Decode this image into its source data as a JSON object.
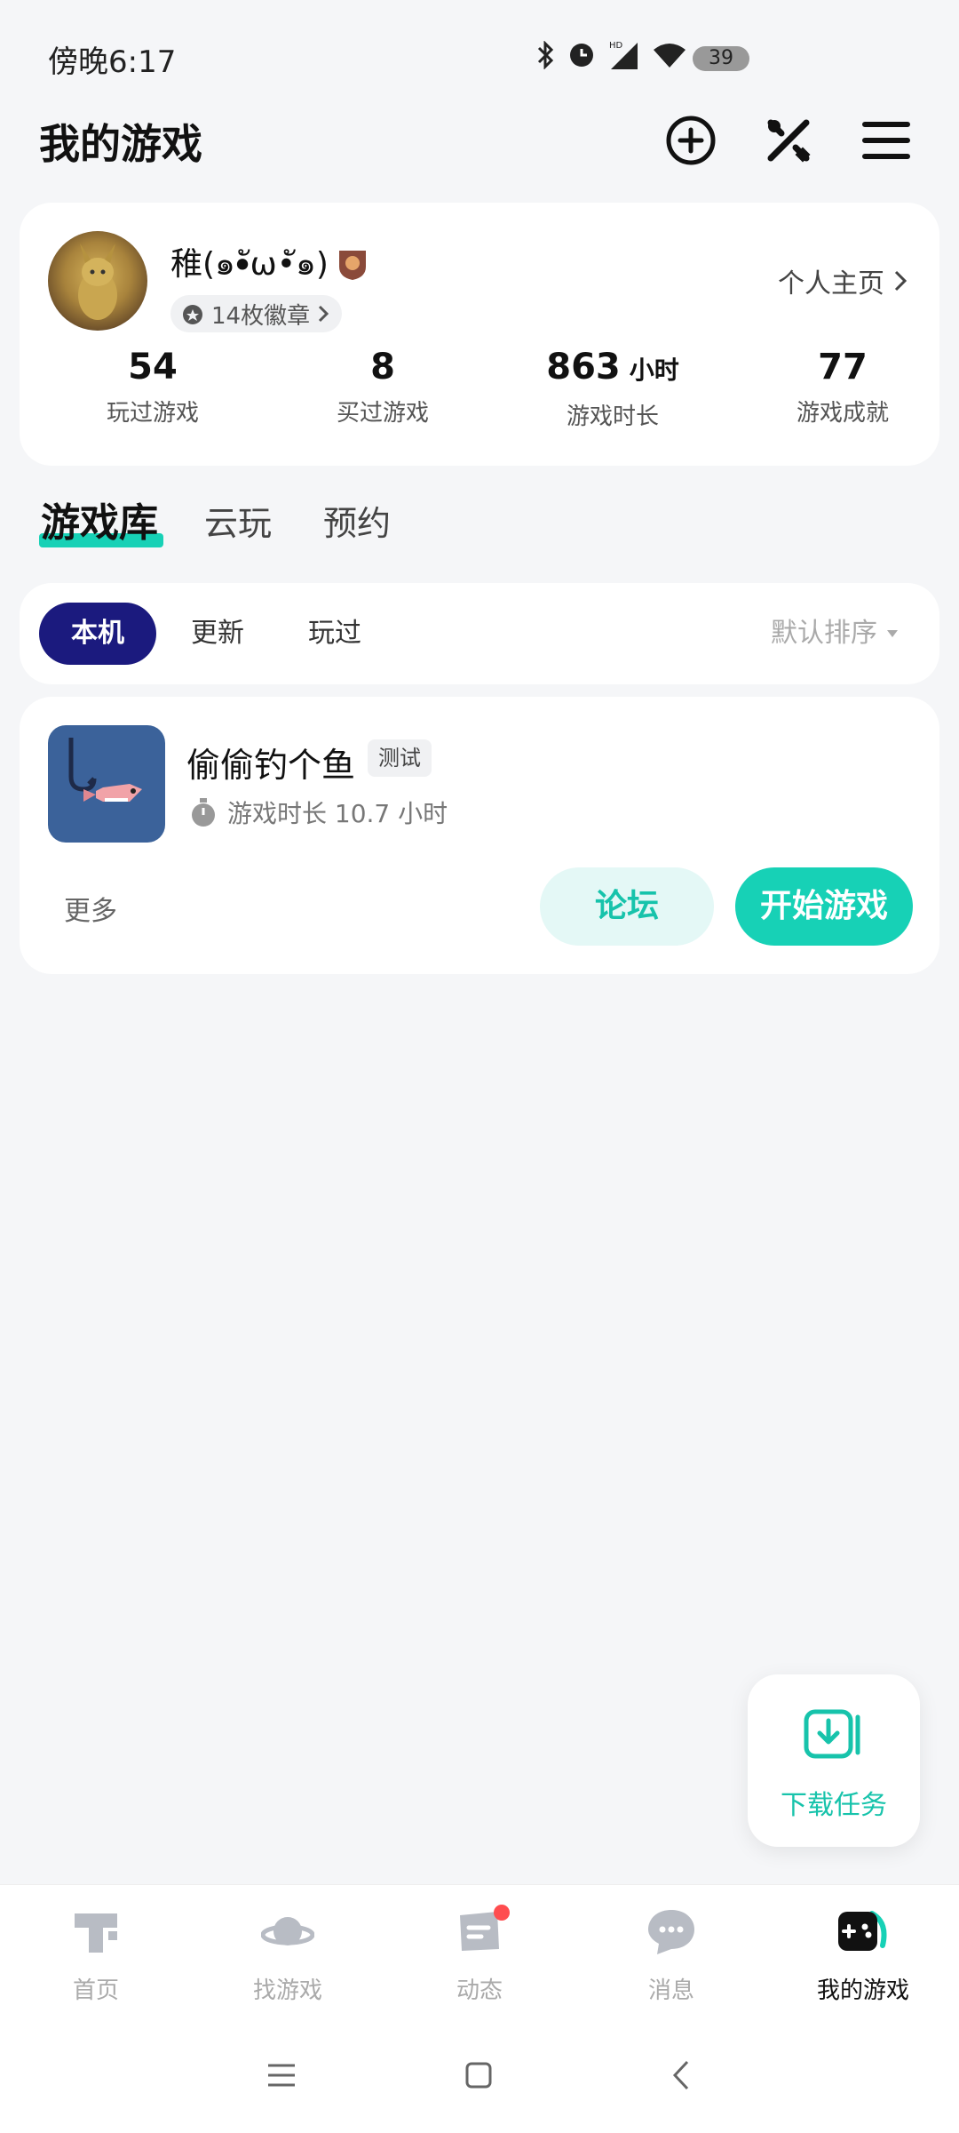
{
  "status_bar": {
    "time": "傍晚6:17",
    "battery": "39"
  },
  "header": {
    "title": "我的游戏"
  },
  "profile": {
    "username": "稚(๑•ัω•ั๑)",
    "medals": "14枚徽章",
    "home_link": "个人主页",
    "stats": [
      {
        "value": "54",
        "unit": "",
        "label": "玩过游戏"
      },
      {
        "value": "8",
        "unit": "",
        "label": "买过游戏"
      },
      {
        "value": "863",
        "unit": "小时",
        "label": "游戏时长"
      },
      {
        "value": "77",
        "unit": "",
        "label": "游戏成就"
      }
    ]
  },
  "tabs": [
    {
      "label": "游戏库"
    },
    {
      "label": "云玩"
    },
    {
      "label": "预约"
    }
  ],
  "filters": {
    "items": [
      {
        "label": "本机"
      },
      {
        "label": "更新"
      },
      {
        "label": "玩过"
      }
    ],
    "sort": "默认排序"
  },
  "game": {
    "name": "偷偷钓个鱼",
    "tag": "测试",
    "playtime": "游戏时长 10.7 小时",
    "more": "更多",
    "forum": "论坛",
    "start": "开始游戏"
  },
  "download_fab": {
    "label": "下载任务"
  },
  "bottom_nav": [
    {
      "label": "首页",
      "icon": "home-icon"
    },
    {
      "label": "找游戏",
      "icon": "planet-icon"
    },
    {
      "label": "动态",
      "icon": "feed-icon"
    },
    {
      "label": "消息",
      "icon": "message-icon"
    },
    {
      "label": "我的游戏",
      "icon": "gamepad-icon"
    }
  ],
  "colors": {
    "accent": "#17d1b6",
    "chip_active": "#1b1a7e",
    "badge_red": "#ff4d4f"
  }
}
